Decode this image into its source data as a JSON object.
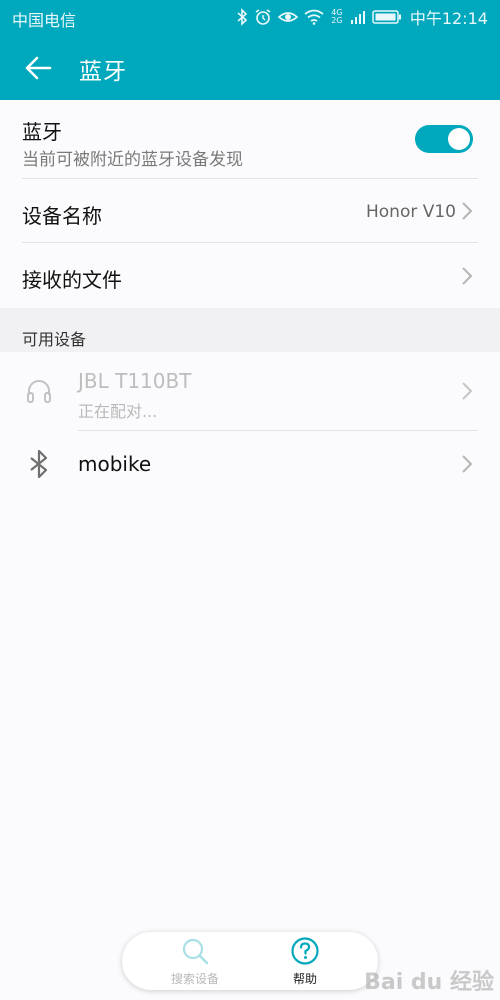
{
  "status_bar": {
    "carrier": "中国电信",
    "network_label_top": "4G",
    "network_label_bottom": "2G",
    "time": "中午12:14",
    "icons": [
      "bluetooth-icon",
      "alarm-icon",
      "eye-icon",
      "wifi-icon",
      "signal-icon",
      "battery-icon"
    ]
  },
  "app_bar": {
    "back_icon": "arrow-left-icon",
    "title": "蓝牙"
  },
  "bluetooth_row": {
    "title": "蓝牙",
    "subtitle": "当前可被附近的蓝牙设备发现",
    "toggle_on": true
  },
  "device_name_row": {
    "title": "设备名称",
    "value": "Honor V10"
  },
  "received_files_row": {
    "title": "接收的文件"
  },
  "available_devices": {
    "section_title": "可用设备",
    "devices": [
      {
        "name": "JBL T110BT",
        "status": "正在配对...",
        "icon": "headphones-icon"
      },
      {
        "name": "mobike",
        "status": "",
        "icon": "bluetooth-icon"
      }
    ]
  },
  "bottom_bar": {
    "search_label": "搜索设备",
    "help_label": "帮助"
  },
  "watermark": "Bai du 经验",
  "colors": {
    "accent": "#00a8bd",
    "background": "#fbfafc",
    "section_bg": "#f1f1f3",
    "disabled_text": "#b9b9b9"
  }
}
